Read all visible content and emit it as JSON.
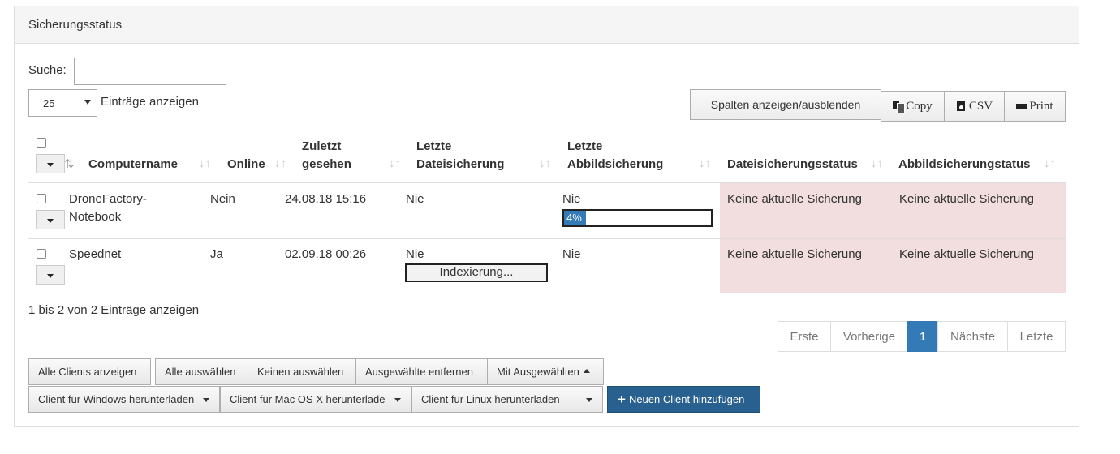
{
  "panel": {
    "title": "Sicherungsstatus"
  },
  "search": {
    "label": "Suche:",
    "value": ""
  },
  "length": {
    "selected": "25",
    "label": "Einträge anzeigen"
  },
  "toolbar": {
    "columns_label": "Spalten anzeigen/ausblenden",
    "copy_label": "Copy",
    "csv_label": "CSV",
    "print_label": "Print"
  },
  "table": {
    "headers": {
      "computername": "Computername",
      "online": "Online",
      "zuletzt_1": "Zuletzt",
      "zuletzt_2": "gesehen",
      "datei_1": "Letzte",
      "datei_2": "Dateisicherung",
      "abbild_1": "Letzte",
      "abbild_2": "Abbildsicherung",
      "dateistatus": "Dateisicherungsstatus",
      "abbildstatus": "Abbildsicherungstatus"
    },
    "rows": [
      {
        "name_1": "DroneFactory-",
        "name_2": "Notebook",
        "online": "Nein",
        "last_seen": "24.08.18 15:16",
        "file_backup": "Nie",
        "image_backup": "Nie",
        "image_progress_label": "4%",
        "image_progress": 0.15,
        "file_status": "Keine aktuelle Sicherung",
        "image_status": "Keine aktuelle Sicherung"
      },
      {
        "name_1": "Speednet",
        "online": "Ja",
        "last_seen": "02.09.18 00:26",
        "file_backup": "Nie",
        "file_indexing": "Indexierung...",
        "image_backup": "Nie",
        "file_status": "Keine aktuelle Sicherung",
        "image_status": "Keine aktuelle Sicherung"
      }
    ]
  },
  "info": "1 bis 2 von 2 Einträge anzeigen",
  "pagination": {
    "first": "Erste",
    "prev": "Vorherige",
    "current": "1",
    "next": "Nächste",
    "last": "Letzte"
  },
  "actions": {
    "all_clients": "Alle Clients anzeigen",
    "select_all": "Alle auswählen",
    "select_none": "Keinen auswählen",
    "remove_selected": "Ausgewählte entfernen",
    "with_selected": "Mit Ausgewählten",
    "dl_windows": "Client für Windows herunterladen",
    "dl_mac": "Client für Mac OS X herunterladen",
    "dl_linux": "Client für Linux herunterladen",
    "add_client": "Neuen Client hinzufügen"
  },
  "colors": {
    "primary": "#337ab7",
    "primary_dark": "#286090",
    "danger_bg": "#f2dede"
  }
}
